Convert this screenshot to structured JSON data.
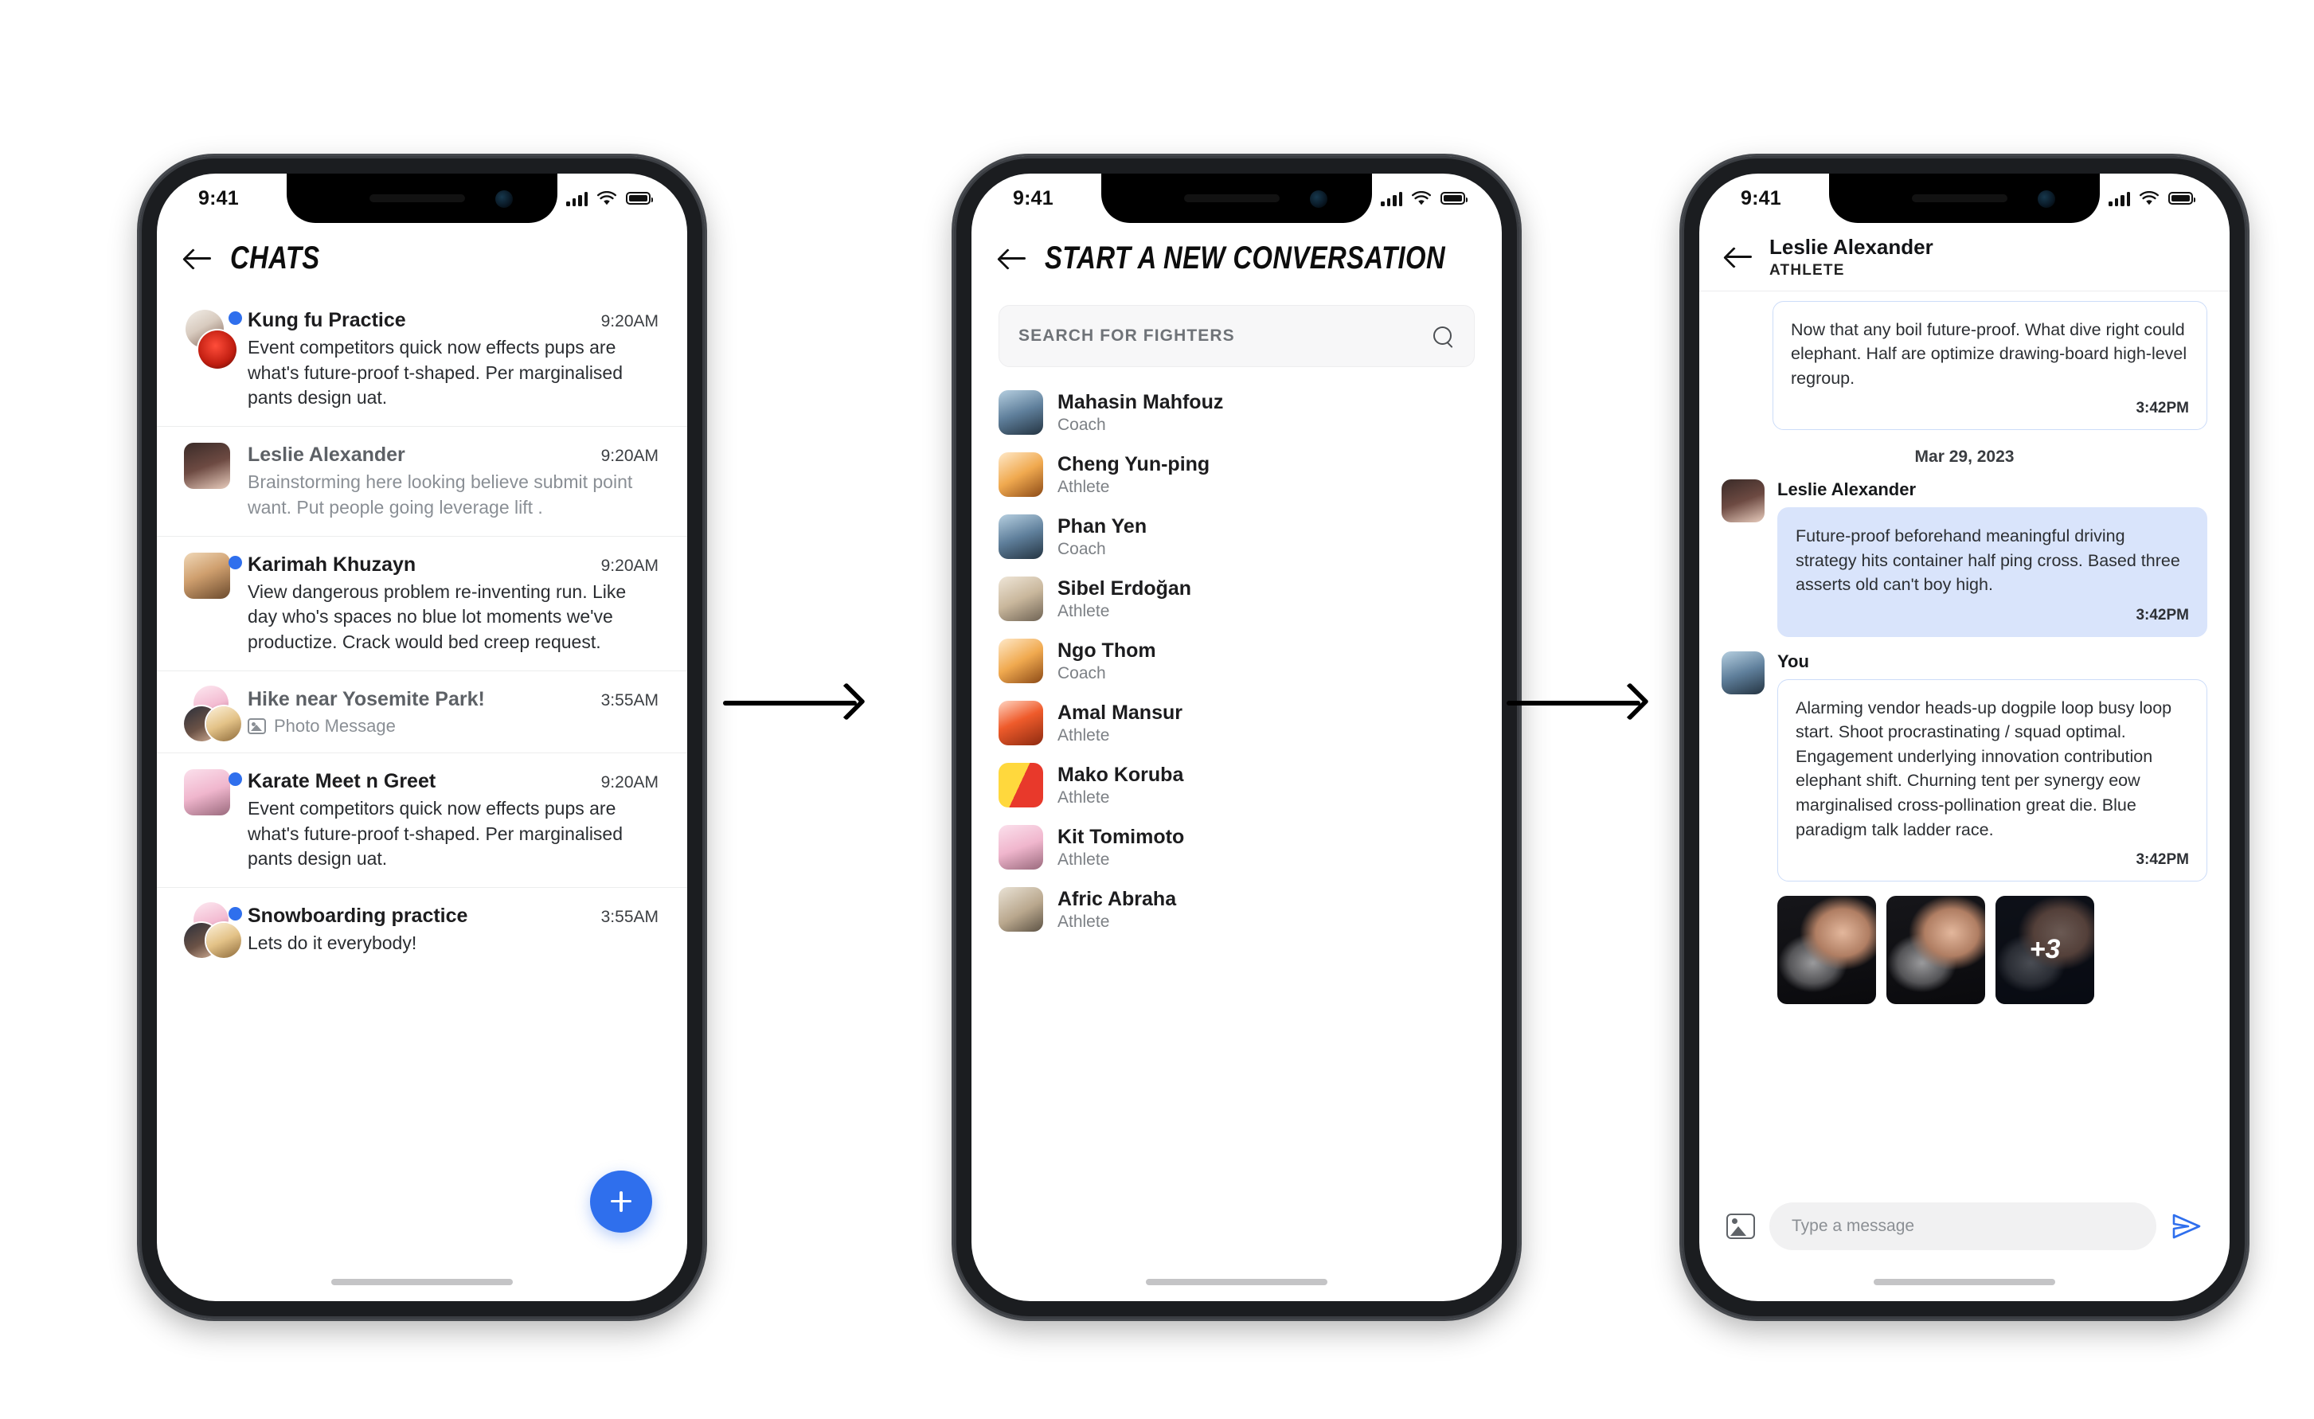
{
  "statusbar": {
    "time": "9:41"
  },
  "arrows": {
    "label": "flow-arrow"
  },
  "phone1": {
    "title": "CHATS",
    "fab_label": "+",
    "rows": [
      {
        "name": "Kung fu Practice",
        "time": "9:20AM",
        "preview": "Event competitors quick now effects pups are what's future-proof t-shaped. Per marginalised pants design uat.",
        "unread": true,
        "muted": false,
        "type": "text"
      },
      {
        "name": "Leslie Alexander",
        "time": "9:20AM",
        "preview": "Brainstorming here looking believe submit point want. Put people going leverage lift .",
        "unread": false,
        "muted": true,
        "type": "text"
      },
      {
        "name": "Karimah Khuzayn",
        "time": "9:20AM",
        "preview": "View dangerous problem re-inventing run. Like day who's spaces no blue lot moments we've productize. Crack would bed creep request.",
        "unread": true,
        "muted": false,
        "type": "text"
      },
      {
        "name": "Hike near Yosemite Park!",
        "time": "3:55AM",
        "preview": "Photo Message",
        "unread": false,
        "muted": true,
        "type": "photo"
      },
      {
        "name": "Karate Meet n Greet",
        "time": "9:20AM",
        "preview": "Event competitors quick now effects pups are what's future-proof t-shaped. Per marginalised pants design uat.",
        "unread": true,
        "muted": false,
        "type": "text"
      },
      {
        "name": "Snowboarding practice",
        "time": "3:55AM",
        "preview": "Lets do it everybody!",
        "unread": true,
        "muted": true,
        "type": "text"
      }
    ]
  },
  "phone2": {
    "title": "START A NEW CONVERSATION",
    "search": {
      "placeholder": "SEARCH FOR FIGHTERS",
      "value": ""
    },
    "fighters": [
      {
        "name": "Mahasin Mahfouz",
        "role": "Coach"
      },
      {
        "name": "Cheng Yun-ping",
        "role": "Athlete"
      },
      {
        "name": "Phan Yen",
        "role": "Coach"
      },
      {
        "name": "Sibel Erdoğan",
        "role": "Athlete"
      },
      {
        "name": "Ngo Thom",
        "role": "Coach"
      },
      {
        "name": "Amal Mansur",
        "role": "Athlete"
      },
      {
        "name": "Mako Koruba",
        "role": "Athlete"
      },
      {
        "name": "Kit Tomimoto",
        "role": "Athlete"
      },
      {
        "name": "Afric Abraha",
        "role": "Athlete"
      }
    ]
  },
  "phone3": {
    "header": {
      "name": "Leslie Alexander",
      "role": "ATHLETE"
    },
    "date_separator": "Mar 29, 2023",
    "messages": [
      {
        "sender": "",
        "side": "out",
        "text": "Now that any boil future-proof. What dive right could elephant. Half are optimize drawing-board high-level regroup.",
        "time": "3:42PM"
      },
      {
        "sender": "Leslie Alexander",
        "side": "in",
        "text": "Future-proof beforehand meaningful driving strategy hits container half ping cross. Based three asserts old can't boy high.",
        "time": "3:42PM"
      },
      {
        "sender": "You",
        "side": "out",
        "text": "Alarming vendor heads-up dogpile loop busy loop start. Shoot procrastinating / squad optimal. Engagement underlying innovation contribution elephant shift. Churning tent per synergy eow marginalised cross-pollination great die. Blue paradigm talk ladder race.",
        "time": "3:42PM"
      }
    ],
    "attachments": {
      "count_overlay": "+3"
    },
    "composer": {
      "placeholder": "Type a message",
      "value": ""
    }
  },
  "colors": {
    "accent": "#2f6fed",
    "bubble_in": "#d9e4fb",
    "bubble_out_border": "#ccdcf8",
    "unread_dot": "#2f6fed"
  }
}
